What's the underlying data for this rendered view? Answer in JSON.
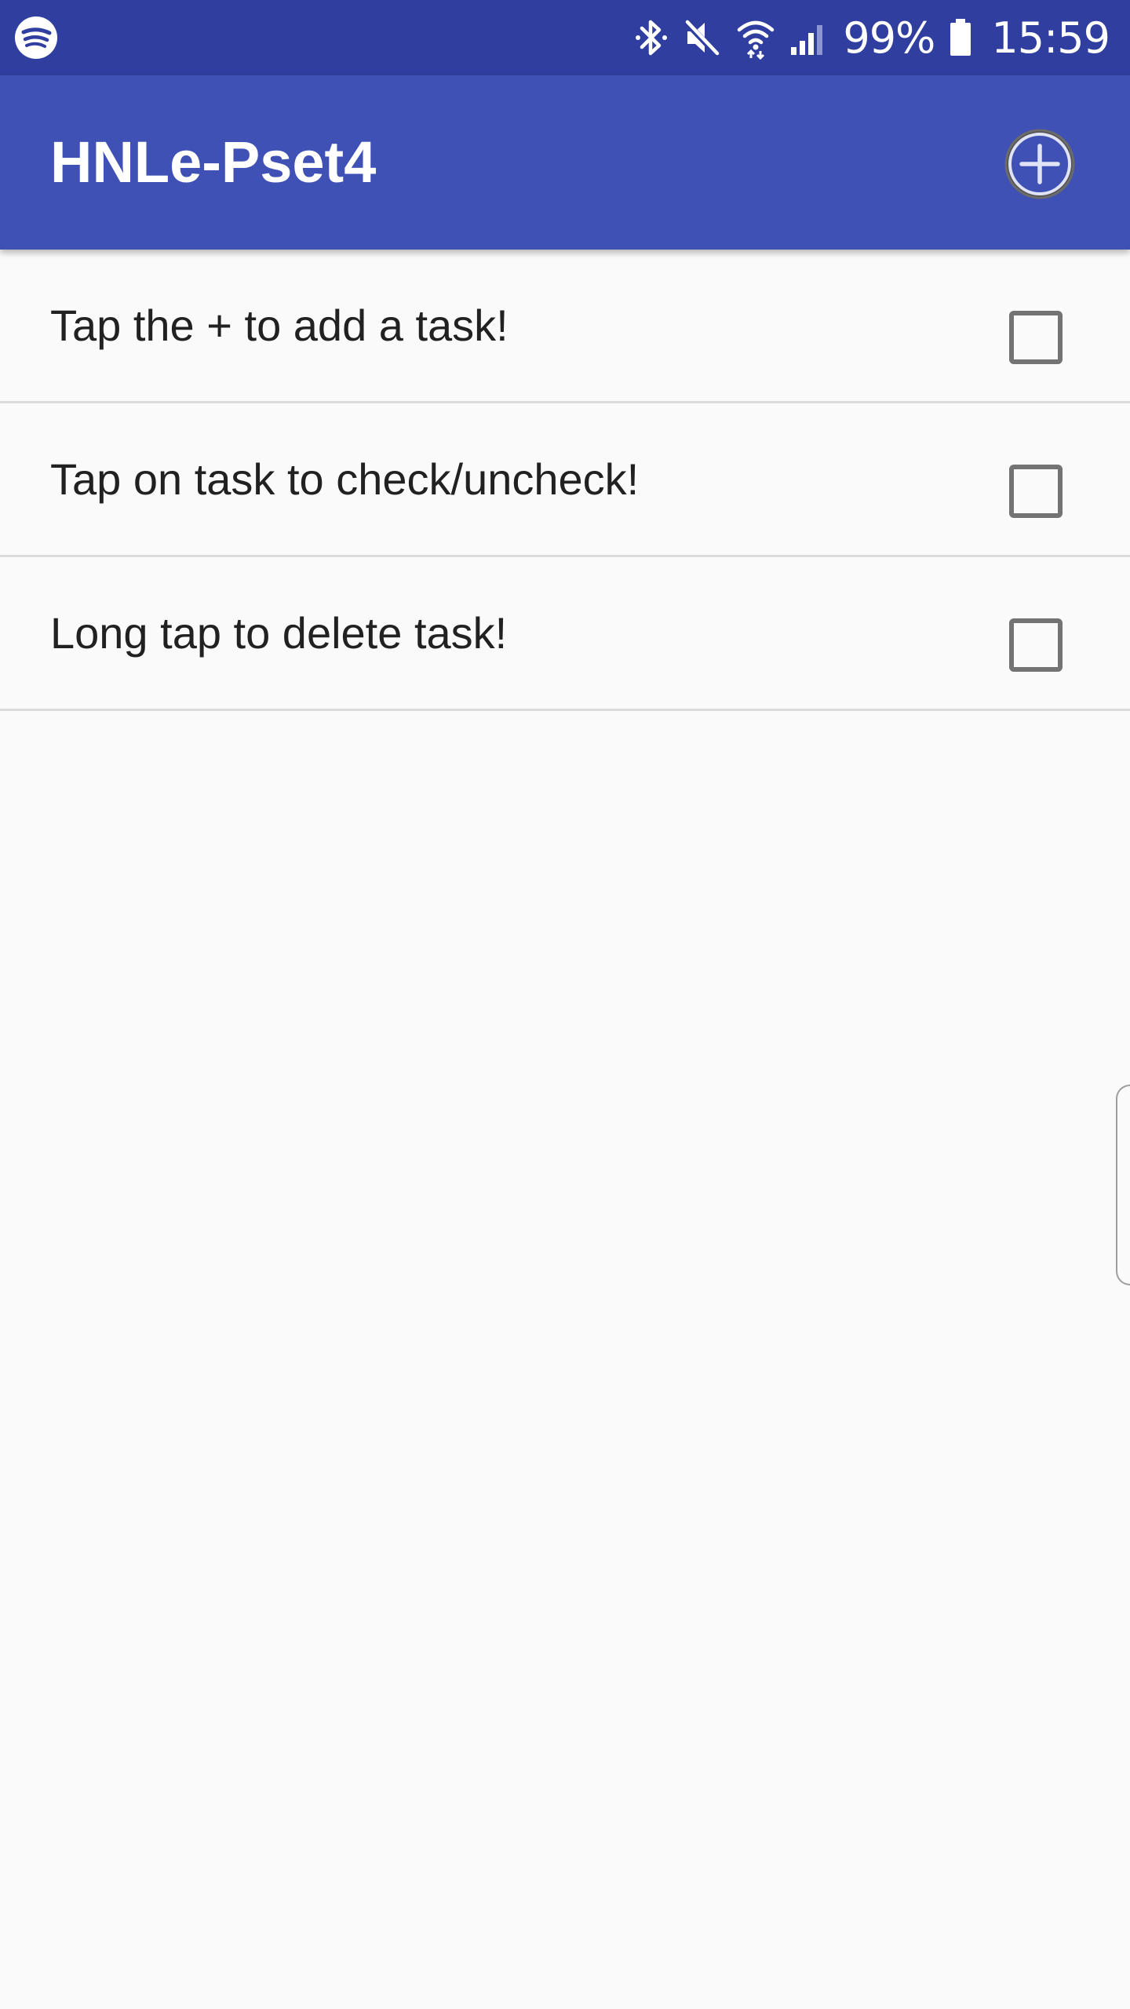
{
  "status_bar": {
    "icons": {
      "app": "spotify-icon",
      "bluetooth": "bluetooth-icon",
      "mute": "mute-icon",
      "wifi": "wifi-icon",
      "signal": "cellular-signal-icon",
      "battery": "battery-icon"
    },
    "battery_percent": "99%",
    "time": "15:59"
  },
  "app_bar": {
    "title": "HNLe-Pset4",
    "add_icon": "add-circle-icon"
  },
  "tasks": [
    {
      "label": "Tap the + to add a task!",
      "checked": false
    },
    {
      "label": "Tap on task to check/uncheck!",
      "checked": false
    },
    {
      "label": "Long tap to delete task!",
      "checked": false
    }
  ],
  "colors": {
    "status_bar": "#303f9f",
    "app_bar": "#3f51b5",
    "background": "#fafafa",
    "text": "#212121",
    "checkbox_border": "#737373",
    "divider": "#dcdcdc"
  }
}
